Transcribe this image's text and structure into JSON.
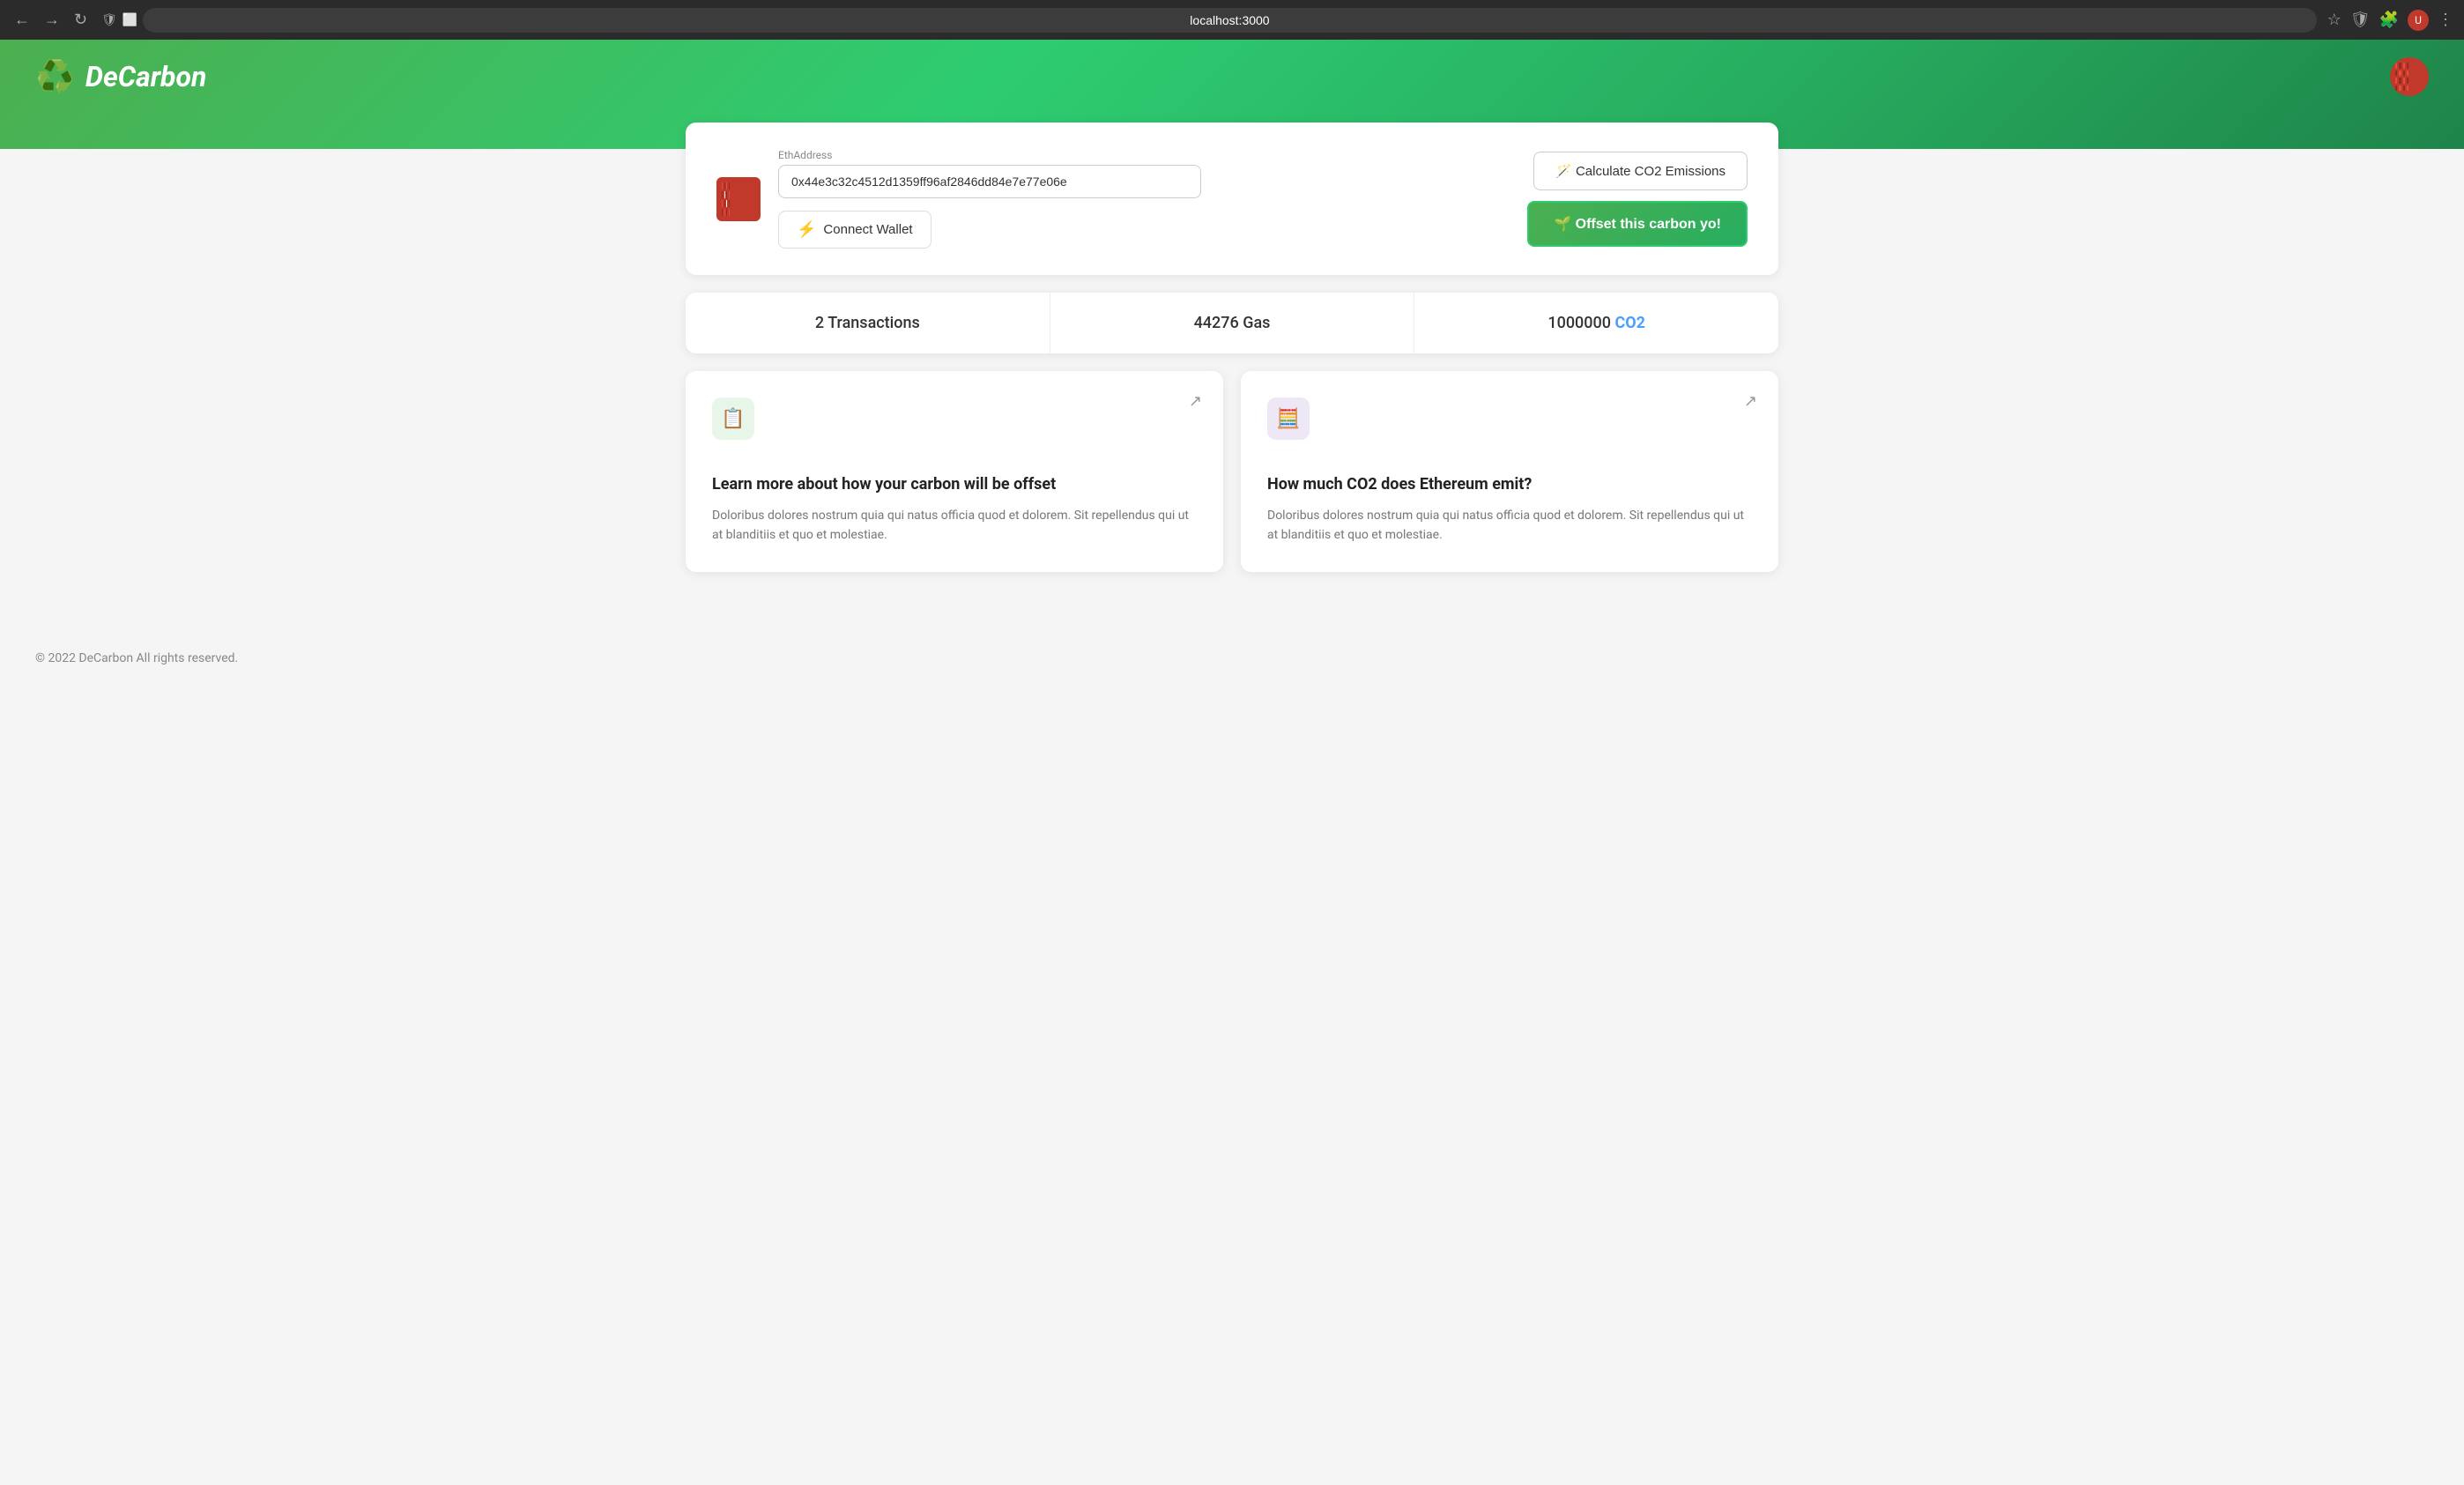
{
  "browser": {
    "url": "localhost:3000"
  },
  "header": {
    "logo_icon": "♻️",
    "logo_text": "DeCarbon"
  },
  "wallet": {
    "eth_label": "EthAddress",
    "eth_address": "0x44e3c32c4512d1359ff96af2846dd84e7e77e06e",
    "connect_wallet_label": "Connect Wallet",
    "calculate_label": "🪄 Calculate CO2 Emissions",
    "offset_label": "🌱 Offset this carbon yo!"
  },
  "stats": {
    "transactions": "2 Transactions",
    "gas": "44276 Gas",
    "co2_amount": "1000000",
    "co2_label": "CO2"
  },
  "info_cards": [
    {
      "icon": "📋",
      "icon_type": "green",
      "title": "Learn more about how your carbon will be offset",
      "description": "Doloribus dolores nostrum quia qui natus officia quod et dolorem. Sit repellendus qui ut at blanditiis et quo et molestiae."
    },
    {
      "icon": "🧮",
      "icon_type": "purple",
      "title": "How much CO2 does Ethereum emit?",
      "description": "Doloribus dolores nostrum quia qui natus officia quod et dolorem. Sit repellendus qui ut at blanditiis et quo et molestiae."
    }
  ],
  "footer": {
    "text": "© 2022 DeCarbon All rights reserved."
  }
}
